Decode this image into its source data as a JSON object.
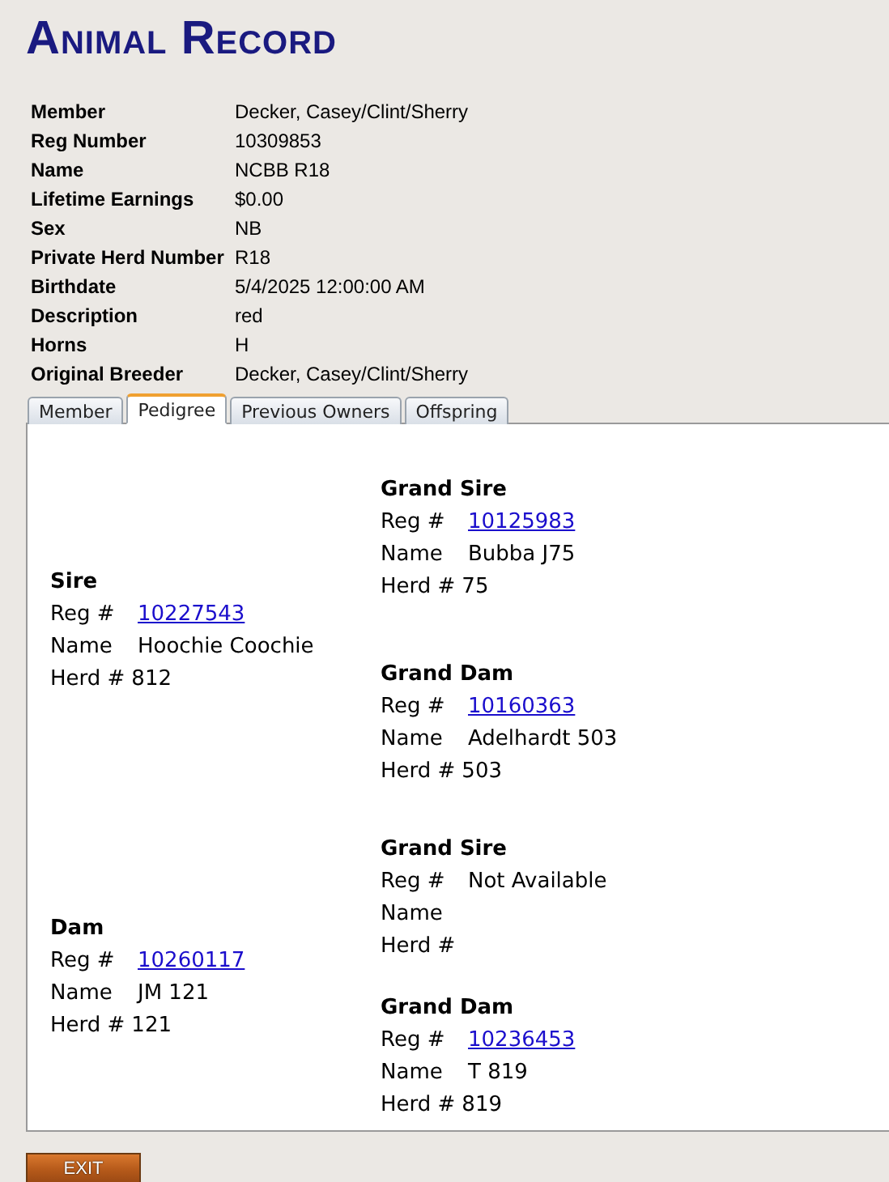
{
  "title": "Animal Record",
  "details": [
    {
      "label": "Member",
      "value": "Decker, Casey/Clint/Sherry"
    },
    {
      "label": "Reg Number",
      "value": "10309853"
    },
    {
      "label": "Name",
      "value": "NCBB R18"
    },
    {
      "label": "Lifetime Earnings",
      "value": "$0.00"
    },
    {
      "label": "Sex",
      "value": "NB"
    },
    {
      "label": "Private Herd Number",
      "value": "R18"
    },
    {
      "label": "Birthdate",
      "value": "5/4/2025 12:00:00 AM"
    },
    {
      "label": "Description",
      "value": "red"
    },
    {
      "label": "Horns",
      "value": "H"
    },
    {
      "label": "Original Breeder",
      "value": "Decker, Casey/Clint/Sherry"
    }
  ],
  "tabs": [
    {
      "label": "Member",
      "selected": false
    },
    {
      "label": "Pedigree",
      "selected": true
    },
    {
      "label": "Previous Owners",
      "selected": false
    },
    {
      "label": "Offspring",
      "selected": false
    }
  ],
  "pedigree": [
    {
      "parent": {
        "heading": "Sire",
        "reg_label": "Reg #",
        "reg": "10227543",
        "linked": true,
        "name_label": "Name",
        "name": "Hoochie Coochie",
        "herd_label": "Herd #",
        "herd": "812"
      },
      "grandparents": [
        {
          "heading": "Grand Sire",
          "reg_label": "Reg #",
          "reg": "10125983",
          "linked": true,
          "name_label": "Name",
          "name": "Bubba J75",
          "herd_label": "Herd #",
          "herd": "75"
        },
        {
          "heading": "Grand Dam",
          "reg_label": "Reg #",
          "reg": "10160363",
          "linked": true,
          "name_label": "Name",
          "name": "Adelhardt 503",
          "herd_label": "Herd #",
          "herd": "503"
        }
      ]
    },
    {
      "parent": {
        "heading": "Dam",
        "reg_label": "Reg #",
        "reg": "10260117",
        "linked": true,
        "name_label": "Name",
        "name": "JM 121",
        "herd_label": "Herd #",
        "herd": "121"
      },
      "grandparents": [
        {
          "heading": "Grand Sire",
          "reg_label": "Reg #",
          "reg": "Not Available",
          "linked": false,
          "name_label": "Name",
          "herd_label": "Herd #"
        },
        {
          "heading": "Grand Dam",
          "reg_label": "Reg #",
          "reg": "10236453",
          "linked": true,
          "name_label": "Name",
          "name": "T 819",
          "herd_label": "Herd #",
          "herd": "819"
        }
      ]
    }
  ],
  "exit_button": "EXIT"
}
